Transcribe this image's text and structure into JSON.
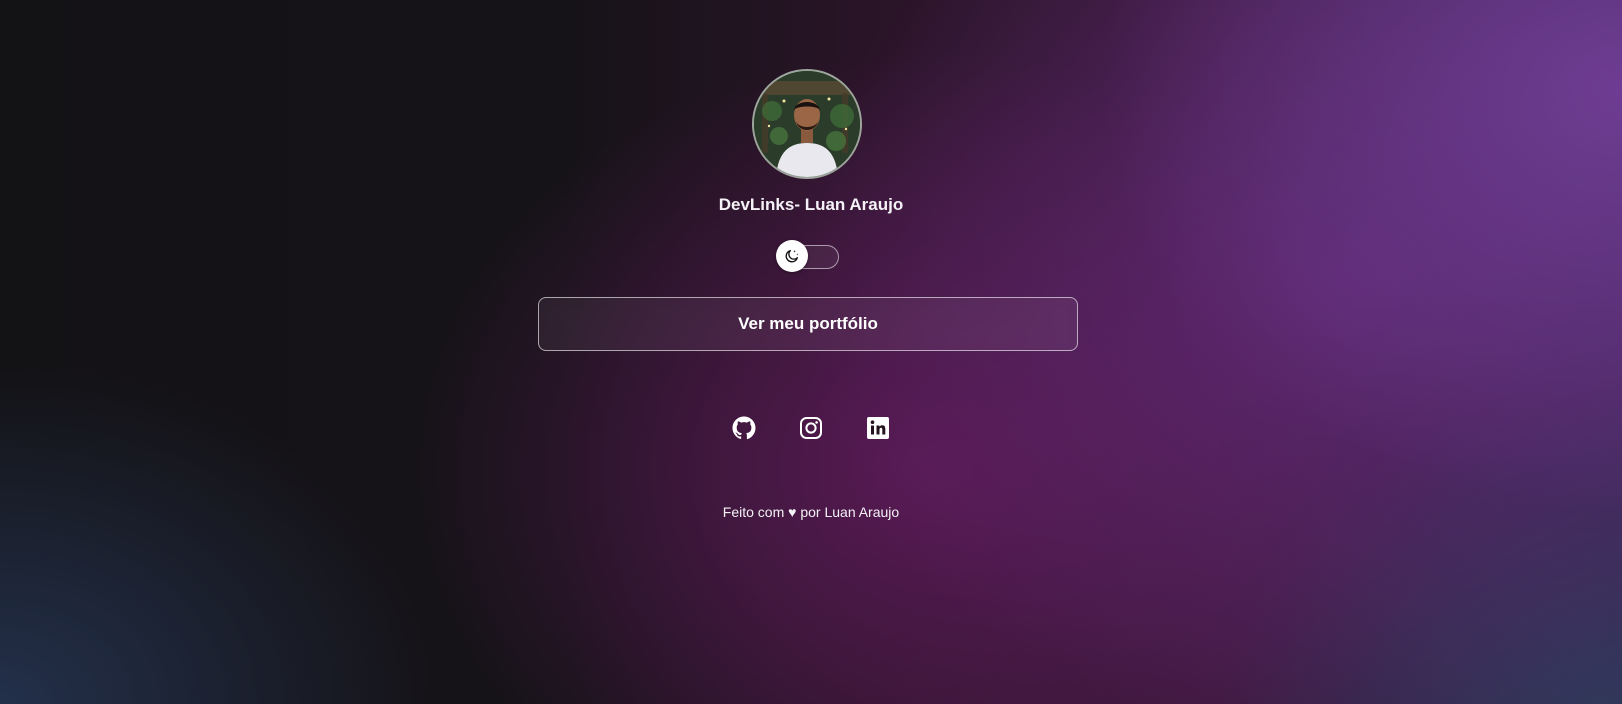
{
  "profile": {
    "name": "DevLinks- Luan Araujo",
    "avatar_alt": "Luan Araujo"
  },
  "theme_switch": {
    "mode": "dark",
    "icon": "moon-icon"
  },
  "links": [
    {
      "label": "Ver meu portfólio"
    }
  ],
  "social": [
    {
      "name": "github",
      "icon": "github-icon"
    },
    {
      "name": "instagram",
      "icon": "instagram-icon"
    },
    {
      "name": "linkedin",
      "icon": "linkedin-icon"
    }
  ],
  "footer": {
    "text": "Feito com ♥ por Luan Araujo"
  },
  "colors": {
    "text": "#ffffff",
    "background_base": "#141217",
    "accent_purple": "#703e96",
    "accent_magenta": "#5a1a56"
  }
}
